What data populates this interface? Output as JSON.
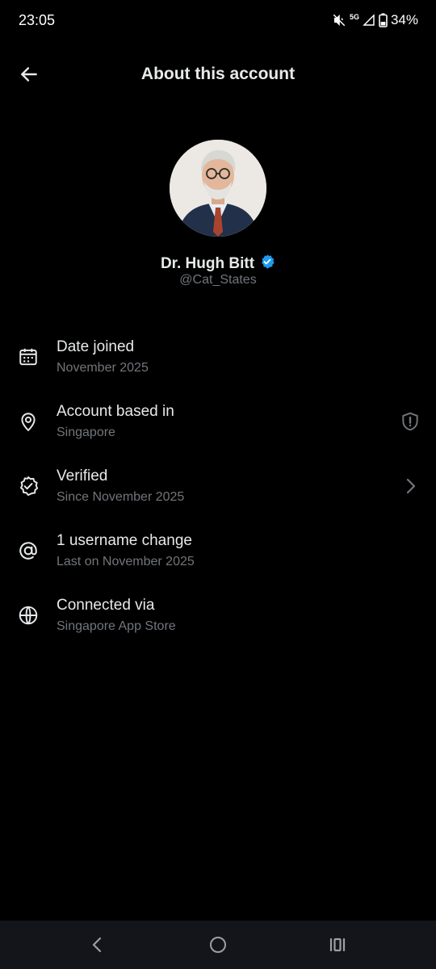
{
  "status_bar": {
    "time": "23:05",
    "network": "5G",
    "battery": "34%",
    "icons": [
      "mute-icon",
      "signal-icon",
      "battery-icon"
    ]
  },
  "header": {
    "title": "About this account",
    "back_icon": "arrow-left-icon"
  },
  "profile": {
    "name": "Dr. Hugh Bitt",
    "handle": "@Cat_States",
    "verified_badge_color": "#1d9bf0"
  },
  "info_items": [
    {
      "title": "Date joined",
      "subtitle": "November 2025",
      "icon": "calendar-icon"
    },
    {
      "title": "Account based in",
      "subtitle": "Singapore",
      "icon": "location-pin-icon",
      "trailing_icon": "shield-alert-icon"
    },
    {
      "title": "Verified",
      "subtitle": "Since November 2025",
      "icon": "verified-badge-outline-icon",
      "trailing_icon": "chevron-right-icon"
    },
    {
      "title": "1 username change",
      "subtitle": "Last on November 2025",
      "icon": "at-sign-icon"
    },
    {
      "title": "Connected via",
      "subtitle": "Singapore App Store",
      "icon": "globe-icon"
    }
  ],
  "nav_bar": {
    "buttons": [
      "nav-back-icon",
      "nav-home-icon",
      "nav-recents-icon"
    ]
  },
  "colors": {
    "background": "#000000",
    "text_primary": "#e7e9ea",
    "text_secondary": "#71767b",
    "accent": "#1d9bf0"
  }
}
